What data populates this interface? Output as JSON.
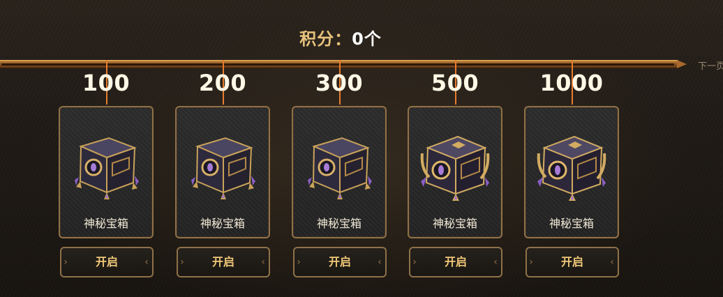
{
  "header": {
    "score_label": "积分：",
    "score_value": "0个"
  },
  "nav": {
    "next_label": "下一页"
  },
  "tiers": [
    {
      "points": "100",
      "name": "神秘宝箱",
      "button": "开启",
      "chest": "small-chest"
    },
    {
      "points": "200",
      "name": "神秘宝箱",
      "button": "开启",
      "chest": "small-chest"
    },
    {
      "points": "300",
      "name": "神秘宝箱",
      "button": "开启",
      "chest": "small-chest"
    },
    {
      "points": "500",
      "name": "神秘宝箱",
      "button": "开启",
      "chest": "large-chest"
    },
    {
      "points": "1000",
      "name": "神秘宝箱",
      "button": "开启",
      "chest": "large-chest"
    }
  ],
  "colors": {
    "score_label": "#e7c27d",
    "button_text": "#f0c878",
    "tick": "#e97c2c",
    "frame": "#8f7149"
  }
}
